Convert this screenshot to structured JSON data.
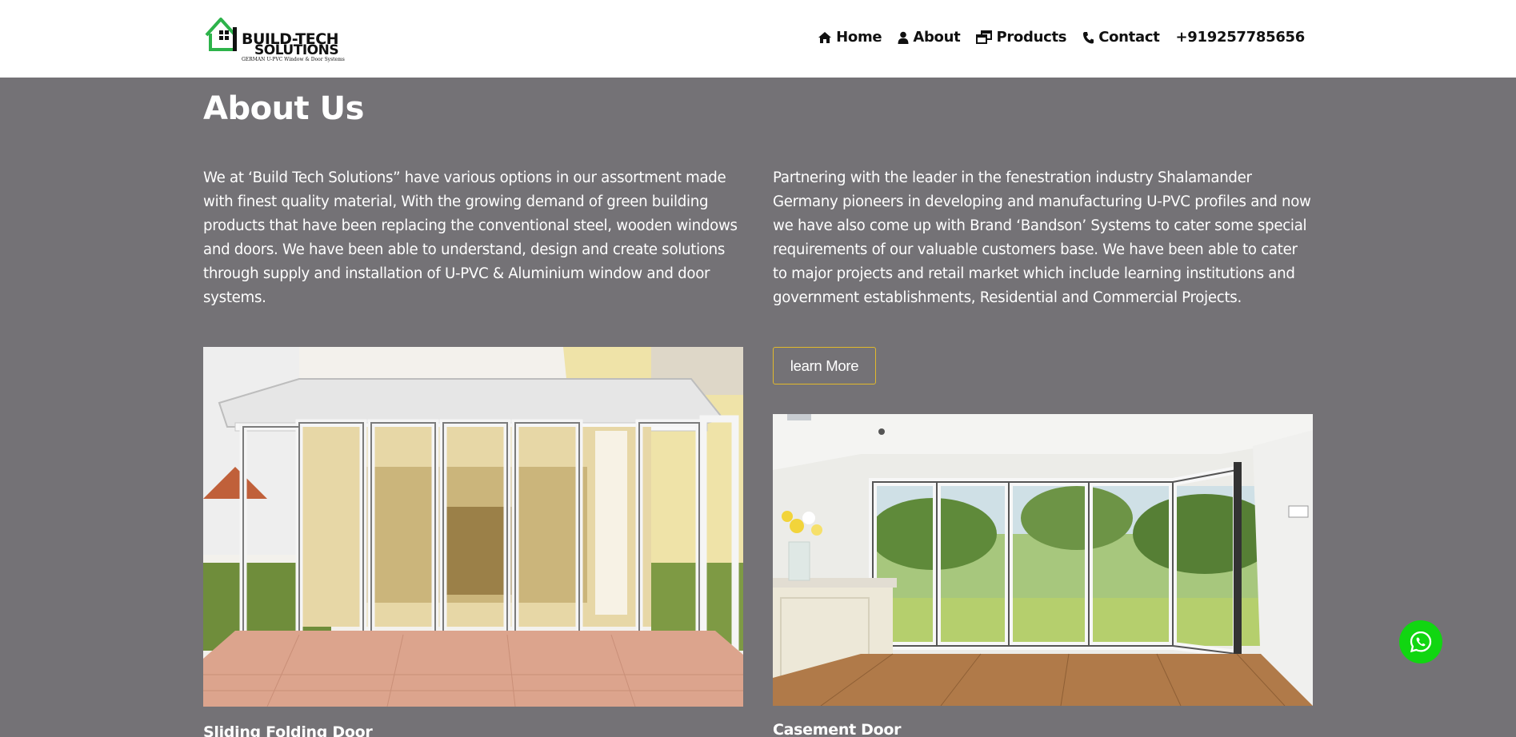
{
  "brand": {
    "line1": "BUILD-TECH",
    "line2": "SOLUTIONS",
    "tagline": "GERMAN U-PVC Window & Door Systems",
    "accent": "#2db34a"
  },
  "nav": {
    "items": [
      {
        "label": "Home",
        "icon": "home-icon"
      },
      {
        "label": "About",
        "icon": "user-icon"
      },
      {
        "label": "Products",
        "icon": "windows-icon"
      },
      {
        "label": "Contact",
        "icon": "phone-icon"
      }
    ],
    "phone": "+919257785656"
  },
  "about": {
    "title": "About Us",
    "paragraph_left": "We at ‘Build Tech Solutions” have various options in our assortment made with finest quality material, With the growing demand of green building products that have been replacing the conventional steel, wooden windows and doors. We have been able to understand, design and create solutions through supply and installation of U-PVC & Aluminium window and door systems.",
    "paragraph_right": "Partnering with the leader in the fenestration industry Shalamander Germany pioneers in developing and manufacturing U-PVC profiles and now we have also come up with Brand ‘Bandson’ Systems to cater some special requirements of our valuable customers base. We have been able to cater to major projects and retail market which include learning institutions and government establishments, Residential and Commercial Projects.",
    "button": "learn More"
  },
  "products": [
    {
      "caption": "Sliding Folding Door"
    },
    {
      "caption": "Casement Door"
    }
  ],
  "colors": {
    "page_bg": "#747276",
    "nav_bg": "#ffffff",
    "button_border": "#e1b92c",
    "whatsapp": "#11d611"
  },
  "floating": {
    "icon": "whatsapp-icon"
  }
}
